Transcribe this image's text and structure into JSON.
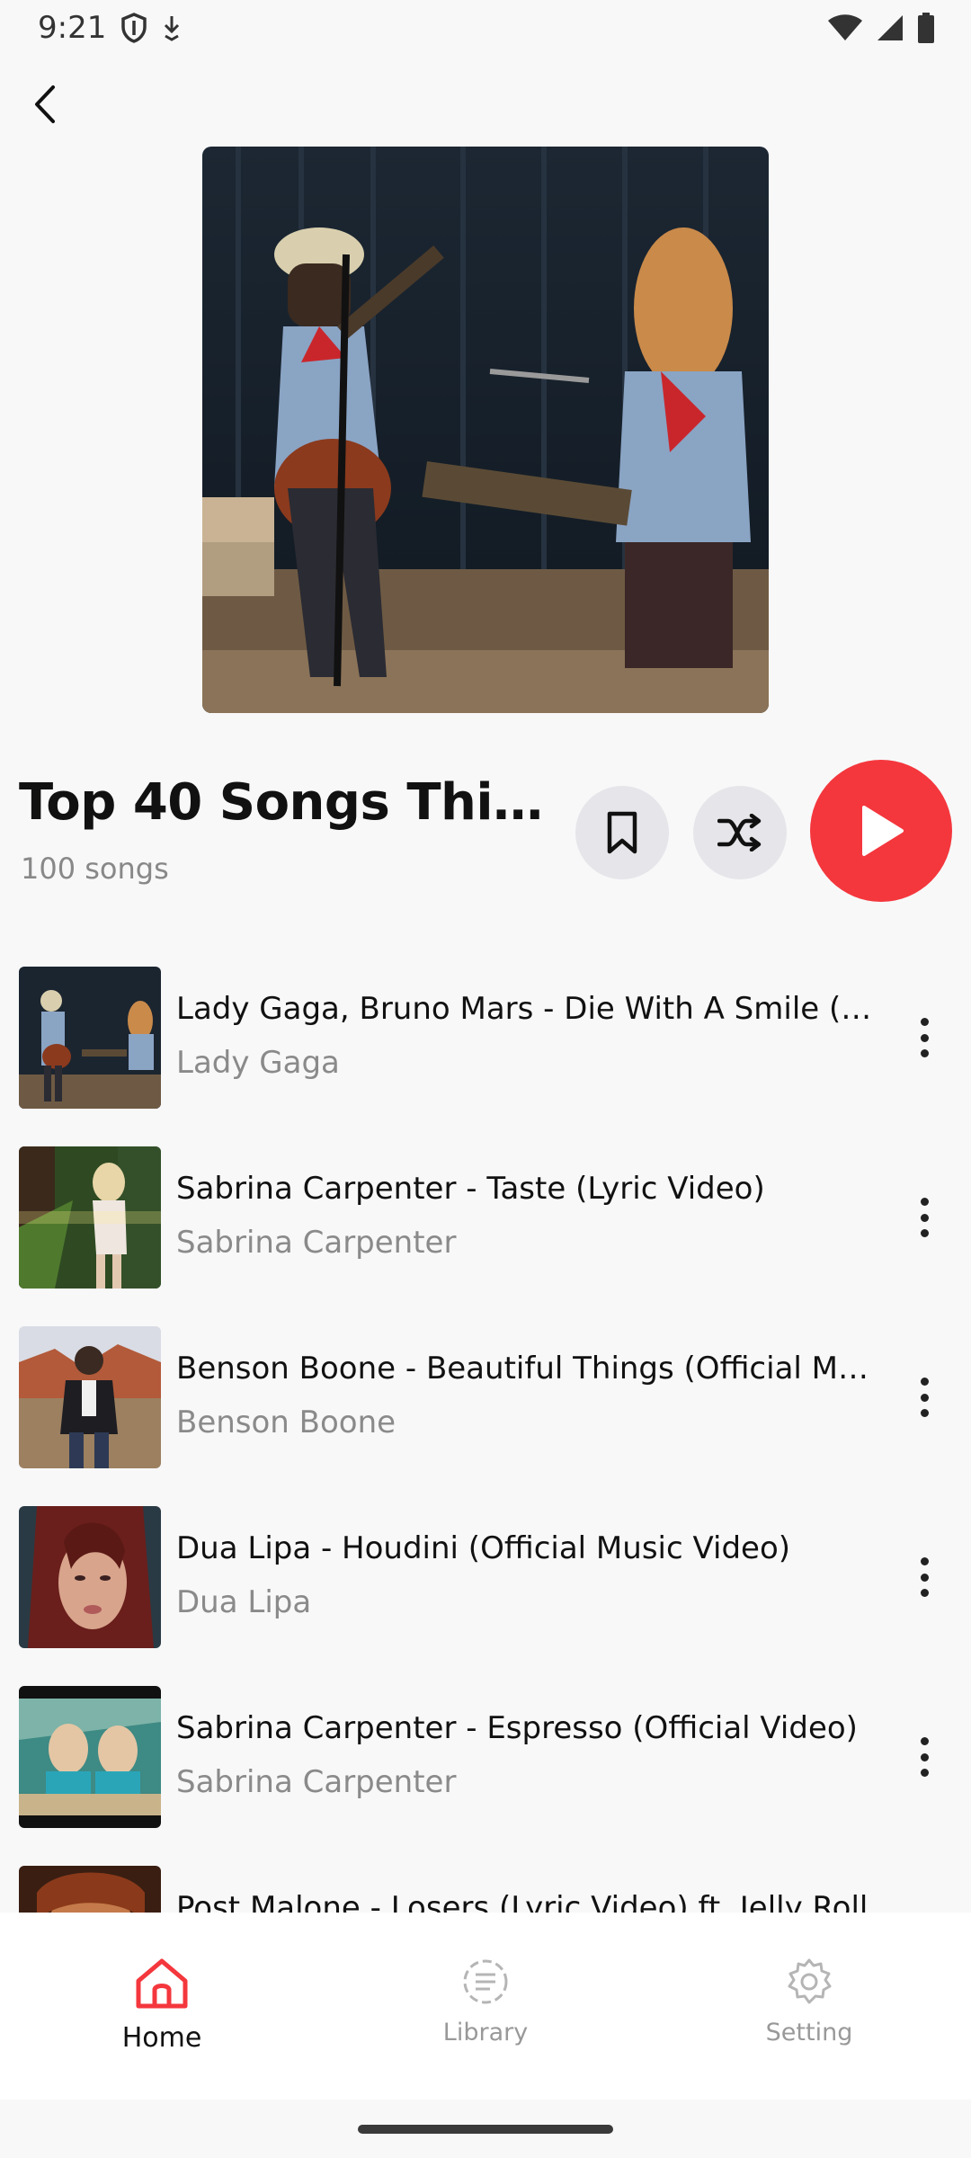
{
  "status_bar": {
    "time": "9:21"
  },
  "playlist": {
    "title": "Top 40 Songs This W...",
    "count": "100 songs"
  },
  "songs": [
    {
      "title": "Lady Gaga, Bruno Mars - Die With A Smile (Off...",
      "artist": "Lady Gaga"
    },
    {
      "title": "Sabrina Carpenter - Taste (Lyric Video)",
      "artist": "Sabrina Carpenter"
    },
    {
      "title": "Benson Boone - Beautiful Things (Official Musi...",
      "artist": "Benson Boone"
    },
    {
      "title": "Dua Lipa - Houdini (Official Music Video)",
      "artist": "Dua Lipa"
    },
    {
      "title": "Sabrina Carpenter - Espresso (Official Video)",
      "artist": "Sabrina Carpenter"
    },
    {
      "title": "Post Malone - Losers (Lyric Video) ft. Jelly Roll",
      "artist": ""
    }
  ],
  "nav": {
    "home": "Home",
    "library": "Library",
    "setting": "Setting"
  },
  "colors": {
    "accent": "#f4373d",
    "button_bg": "#e6e6ea"
  }
}
